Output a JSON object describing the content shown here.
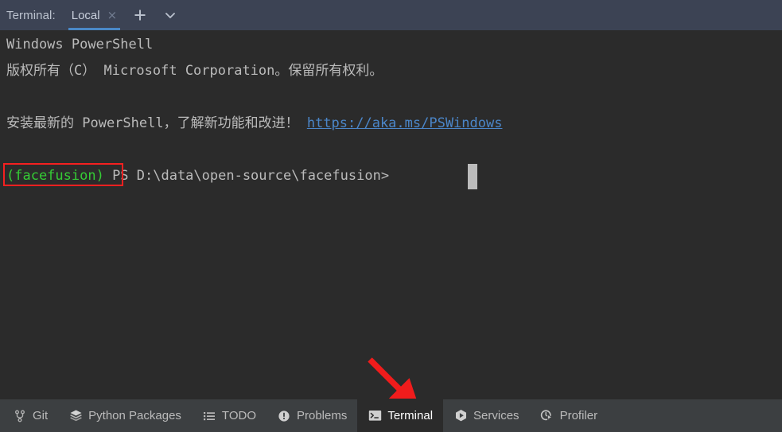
{
  "header": {
    "title": "Terminal:",
    "tab": {
      "label": "Local",
      "close_glyph": "×"
    },
    "add_button_name": "add-terminal-tab",
    "dropdown_button_name": "terminal-tabs-dropdown"
  },
  "terminal": {
    "lines": [
      {
        "text": "Windows PowerShell"
      },
      {
        "text": "版权所有（C） Microsoft Corporation。保留所有权利。"
      },
      {
        "text": "安装最新的 PowerShell，了解新功能和改进！ "
      }
    ],
    "link": "https://aka.ms/PSWindows",
    "prompt": {
      "env": "(facefusion)",
      "text": " PS D:\\data\\open-source\\facefusion> "
    },
    "colors": {
      "background": "#2b2b2b",
      "foreground": "#bbbbbb",
      "link": "#4b86c9",
      "env": "#35cc35",
      "cursor": "#bcbcbc",
      "annotation_red": "#f42020"
    }
  },
  "bottom_bar": {
    "items": [
      {
        "label": "Git",
        "icon": "git-branch-icon",
        "active": false
      },
      {
        "label": "Python Packages",
        "icon": "layers-icon",
        "active": false
      },
      {
        "label": "TODO",
        "icon": "list-icon",
        "active": false
      },
      {
        "label": "Problems",
        "icon": "exclamation-circle-icon",
        "active": false
      },
      {
        "label": "Terminal",
        "icon": "terminal-prompt-icon",
        "active": true
      },
      {
        "label": "Services",
        "icon": "play-hexagon-icon",
        "active": false
      },
      {
        "label": "Profiler",
        "icon": "profiler-clock-icon",
        "active": false
      }
    ]
  }
}
